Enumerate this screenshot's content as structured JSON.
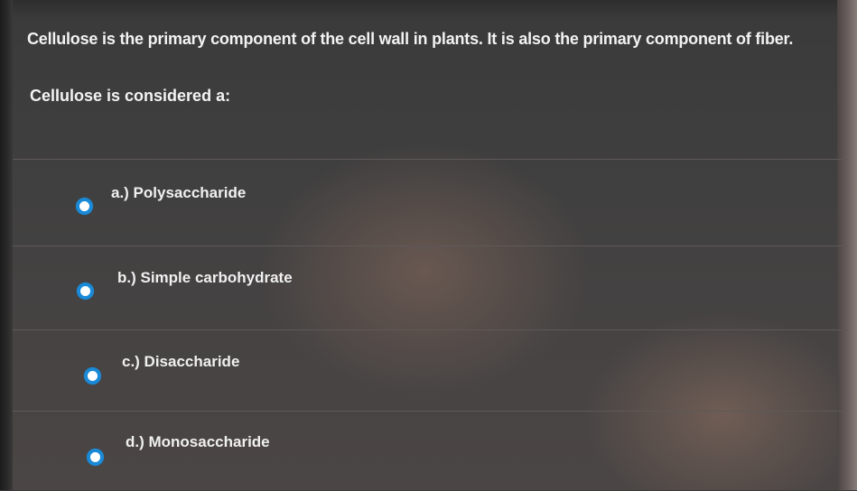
{
  "question": {
    "text": "Cellulose is the primary component of the cell wall in plants. It is also the primary component of fiber.",
    "prompt": "Cellulose is considered a:"
  },
  "options": [
    {
      "label": "a.) Polysaccharide",
      "selected": false
    },
    {
      "label": "b.) Simple carbohydrate",
      "selected": false
    },
    {
      "label": "c.) Disaccharide",
      "selected": false
    },
    {
      "label": "d.) Monosaccharide",
      "selected": false
    }
  ],
  "colors": {
    "background": "#3c3a39",
    "text": "#f1f1f1",
    "radio_accent": "#1a8ad8",
    "divider": "#5d5958"
  }
}
